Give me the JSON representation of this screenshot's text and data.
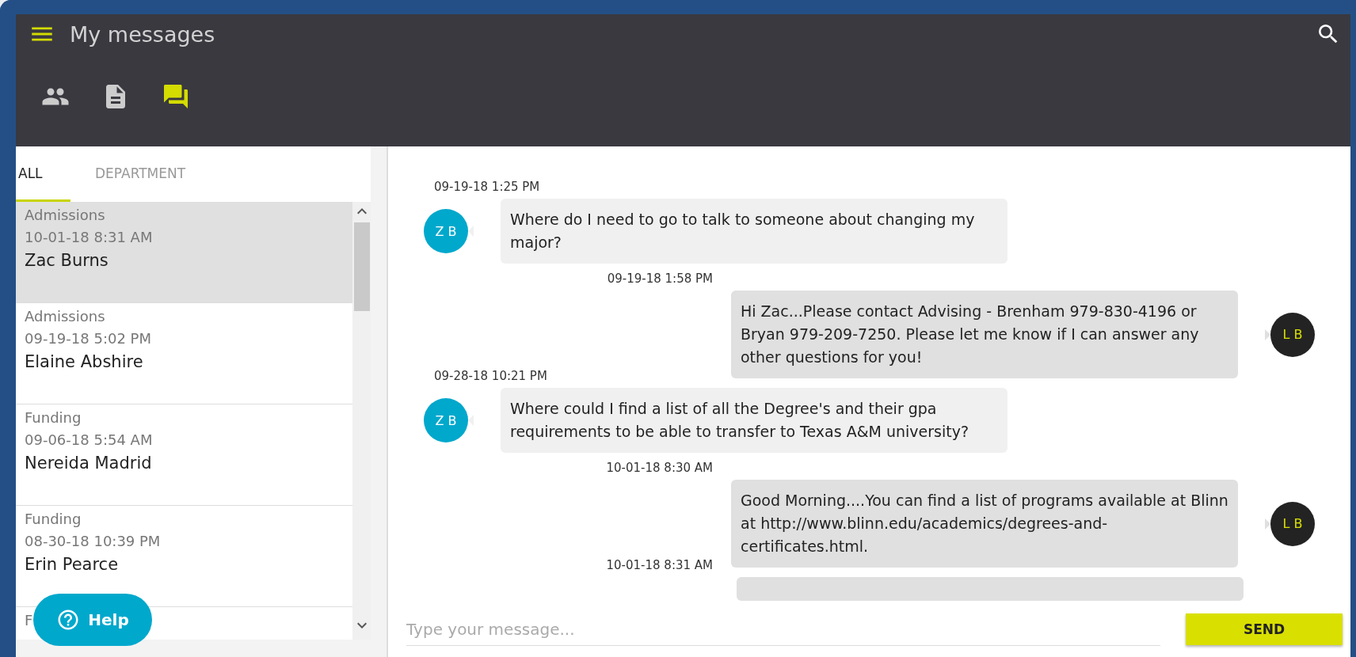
{
  "header": {
    "title": "My messages"
  },
  "nav_icons": [
    {
      "kind": "people",
      "selected": false
    },
    {
      "kind": "document",
      "selected": false
    },
    {
      "kind": "chat",
      "selected": true
    }
  ],
  "tabs": [
    {
      "label": "ALL",
      "selected": true
    },
    {
      "label": "DEPARTMENT",
      "selected": false
    }
  ],
  "conversations": [
    {
      "category": "Admissions",
      "time": "10-01-18 8:31 AM",
      "name": "Zac Burns",
      "selected": true
    },
    {
      "category": "Admissions",
      "time": "09-19-18 5:02 PM",
      "name": "Elaine Abshire",
      "selected": false
    },
    {
      "category": "Funding",
      "time": "09-06-18 5:54 AM",
      "name": "Nereida Madrid",
      "selected": false
    },
    {
      "category": "Funding",
      "time": "08-30-18 10:39 PM",
      "name": "Erin Pearce",
      "selected": false
    },
    {
      "category": "F",
      "selected": false
    }
  ],
  "messages": [
    {
      "kind": "incoming",
      "time": "09-19-18 1:25 PM",
      "initials": "Z B",
      "text": "Where do I need to go to talk to someone about changing my major?"
    },
    {
      "kind": "outgoing",
      "time": "09-19-18 1:58 PM",
      "initials": "L B",
      "text": "Hi Zac...Please contact Advising - Brenham 979-830-4196 or Bryan 979-209-7250. Please let me know if I can answer any other questions for you!"
    },
    {
      "kind": "incoming",
      "time": "09-28-18 10:21 PM",
      "initials": "Z B",
      "text": "Where could I find a list of all the Degree's and their gpa requirements to be able to transfer to Texas A&M university?"
    },
    {
      "kind": "outgoing",
      "time": "10-01-18 8:30 AM",
      "initials": "L B",
      "text": "Good Morning....You can find a list of programs available at Blinn at http://www.blinn.edu/academics/degrees-and-certificates.html."
    },
    {
      "kind": "outgoing",
      "time": "10-01-18 8:31 AM"
    }
  ],
  "composer": {
    "placeholder": "Type your message...",
    "button": "SEND"
  },
  "help": {
    "label": "Help"
  }
}
